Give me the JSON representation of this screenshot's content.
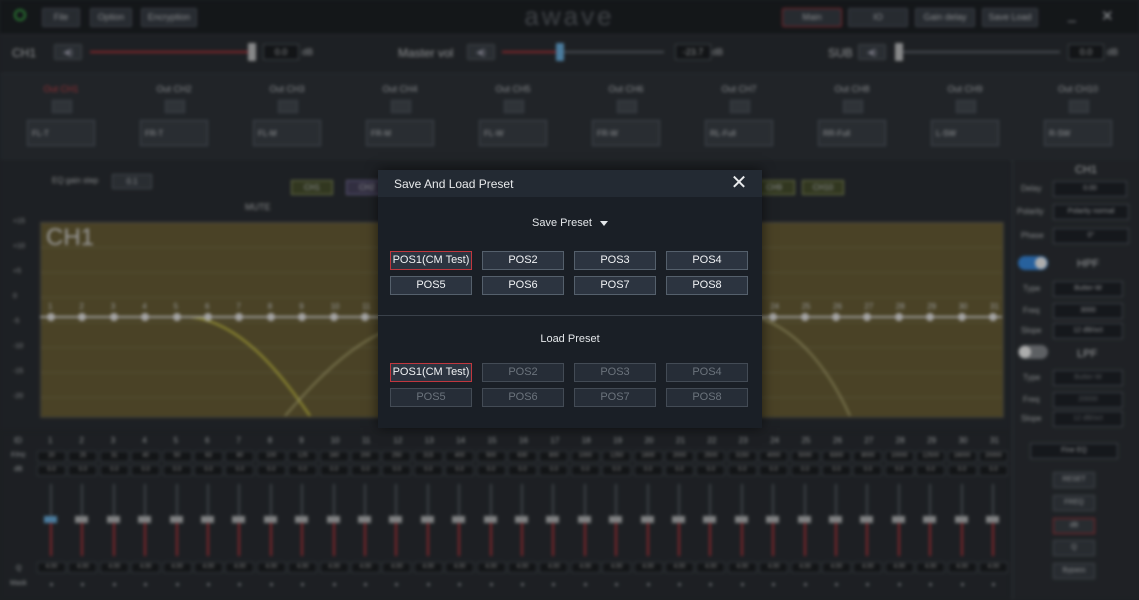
{
  "topbar": {
    "file": "File",
    "option": "Option",
    "encryption": "Encryption",
    "logo": "awave",
    "main": "Main",
    "io": "IO",
    "gain_delay": "Gain delay",
    "save_load": "Save Load",
    "minimize": "_",
    "close": "✕"
  },
  "volume": {
    "ch1_label": "CH1",
    "ch1_value": "0.0",
    "master_label": "Master vol",
    "master_value": "-23.7",
    "sub_label": "SUB",
    "sub_value": "0.0",
    "unit": "dB"
  },
  "outputs": [
    {
      "label": "Out CH1",
      "assign": "FL-T"
    },
    {
      "label": "Out CH2",
      "assign": "FR-T"
    },
    {
      "label": "Out CH3",
      "assign": "FL-M"
    },
    {
      "label": "Out CH4",
      "assign": "FR-M"
    },
    {
      "label": "Out CH5",
      "assign": "FL-W"
    },
    {
      "label": "Out CH6",
      "assign": "FR-W"
    },
    {
      "label": "Out CH7",
      "assign": "RL-Full"
    },
    {
      "label": "Out CH8",
      "assign": "RR-Full"
    },
    {
      "label": "Out CH9",
      "assign": "L-SW"
    },
    {
      "label": "Out CH10",
      "assign": "R-SW"
    }
  ],
  "eq": {
    "gain_step_label": "EQ gain step",
    "gain_step_value": "0.1",
    "mute_label": "MUTE",
    "channel_label": "CH1",
    "y_ticks": [
      "+15",
      "+10",
      "+5",
      "0",
      "-5",
      "-10",
      "-15",
      "-20"
    ],
    "band_count": 31,
    "freq_label": "F/Hz",
    "db_label": "dB",
    "q_label": "Q",
    "mask_label": "Mask",
    "id_label": "ID",
    "freqs": [
      "20",
      "25",
      "31",
      "40",
      "50",
      "63",
      "80",
      "100",
      "125",
      "160",
      "200",
      "250",
      "315",
      "400",
      "500",
      "630",
      "800",
      "1000",
      "1250",
      "1600",
      "2000",
      "2500",
      "3150",
      "4000",
      "5000",
      "6300",
      "8000",
      "10000",
      "12500",
      "16000",
      "20000"
    ],
    "gain_value": "0.0",
    "q_value": "4.00",
    "ch_tags": [
      "CH1",
      "CH2",
      "CH9",
      "CH10"
    ]
  },
  "right_panel": {
    "channel": "CH1",
    "delay_label": "Delay",
    "delay_value": "0.00",
    "polarity_label": "Polarity",
    "polarity_value": "Polarity normal",
    "phase_label": "Phase",
    "phase_value": "0°",
    "hpf": "HPF",
    "lpf": "LPF",
    "type_label": "Type",
    "type_value": "Butter-W",
    "freq_label": "Freq",
    "hpf_freq": "3000",
    "lpf_freq": "20000",
    "slope_label": "Slope",
    "slope_value": "12 dB/oct",
    "eq_mode": "Fine EQ",
    "reset": "RESET",
    "freq_btn": "FREQ",
    "db_btn": "dB",
    "q_btn": "Q",
    "bypass": "Bypass"
  },
  "dialog": {
    "title": "Save And Load Preset",
    "close": "✕",
    "save_title": "Save Preset",
    "load_title": "Load Preset",
    "save_presets": [
      "POS1(CM Test)",
      "POS2",
      "POS3",
      "POS4",
      "POS5",
      "POS6",
      "POS7",
      "POS8"
    ],
    "load_presets": [
      "POS1(CM Test)",
      "POS2",
      "POS3",
      "POS4",
      "POS5",
      "POS6",
      "POS7",
      "POS8"
    ]
  }
}
